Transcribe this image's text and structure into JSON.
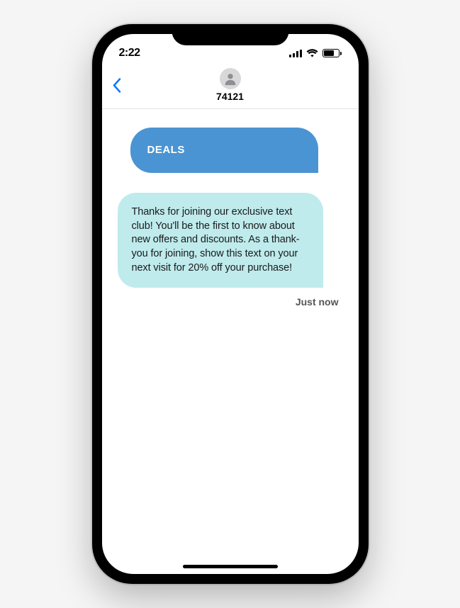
{
  "status": {
    "time": "2:22"
  },
  "header": {
    "contact": "74121"
  },
  "messages": {
    "sent": {
      "text": "DEALS"
    },
    "received": {
      "text": "Thanks for joining our exclusive text club! You'll be the first to know about new offers and discounts. As a thank-you for joining, show this text on your next visit for 20% off your purchase!",
      "timestamp": "Just now"
    }
  }
}
